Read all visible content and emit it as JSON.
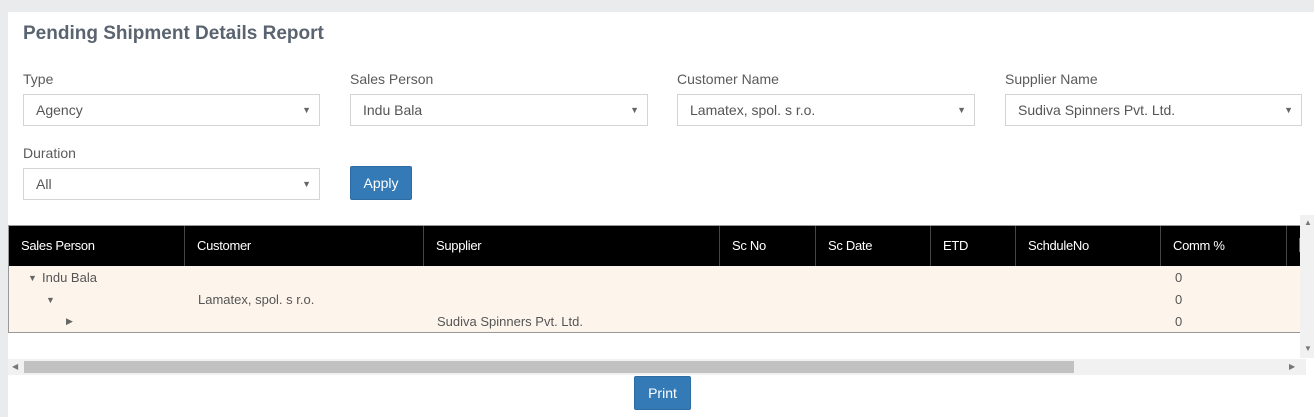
{
  "title": "Pending Shipment Details Report",
  "filters": {
    "type": {
      "label": "Type",
      "value": "Agency"
    },
    "sales_person": {
      "label": "Sales Person",
      "value": "Indu Bala"
    },
    "customer_name": {
      "label": "Customer Name",
      "value": "Lamatex, spol. s r.o."
    },
    "supplier_name": {
      "label": "Supplier Name",
      "value": "Sudiva Spinners Pvt. Ltd."
    },
    "duration": {
      "label": "Duration",
      "value": "All"
    }
  },
  "apply_label": "Apply",
  "print_label": "Print",
  "grid": {
    "columns": [
      "Sales Person",
      "Customer",
      "Supplier",
      "Sc No",
      "Sc Date",
      "ETD",
      "SchduleNo",
      "Comm %"
    ],
    "rows": [
      {
        "text": "Indu Bala",
        "comm": "0"
      },
      {
        "text": "Lamatex, spol. s r.o.",
        "comm": "0"
      },
      {
        "text": "Sudiva Spinners Pvt. Ltd.",
        "comm": "0"
      }
    ]
  },
  "colors": {
    "accent": "#337ab7",
    "header_bg": "#000000",
    "row_bg": "#fdf5ec"
  },
  "icons": {
    "dropdown": "caret-down-icon",
    "expanded": "triangle-down-icon",
    "collapsed": "triangle-right-icon"
  }
}
